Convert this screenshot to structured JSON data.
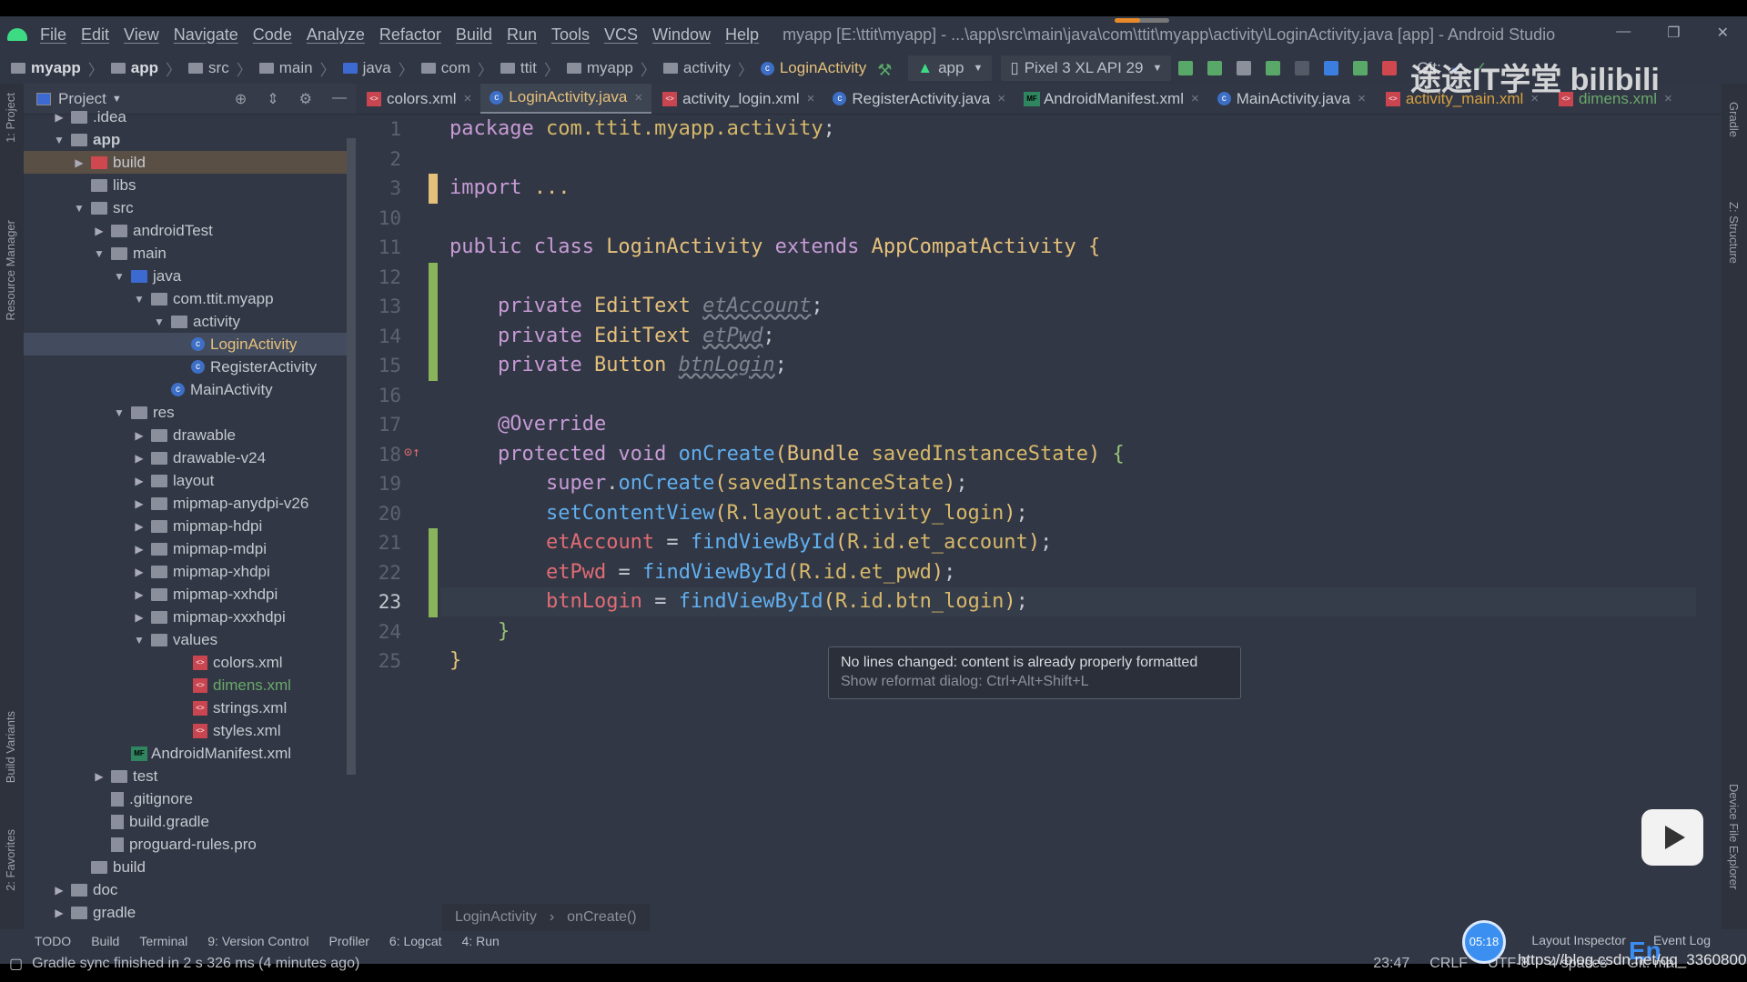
{
  "window": {
    "title": "myapp [E:\\ttit\\myapp] - ...\\app\\src\\main\\java\\com\\ttit\\myapp\\activity\\LoginActivity.java [app] - Android Studio",
    "menu": [
      "File",
      "Edit",
      "View",
      "Navigate",
      "Code",
      "Analyze",
      "Refactor",
      "Build",
      "Run",
      "Tools",
      "VCS",
      "Window",
      "Help"
    ]
  },
  "breadcrumb": [
    "myapp",
    "app",
    "src",
    "main",
    "java",
    "com",
    "ttit",
    "myapp",
    "activity",
    "LoginActivity"
  ],
  "toolbar": {
    "run_config": "app",
    "device": "Pixel 3 XL API 29",
    "git_label": "Git:"
  },
  "project_panel": {
    "title": "Project",
    "items": [
      {
        "label": ".idea",
        "depth": 1,
        "arrow": "▶",
        "icon": "folder"
      },
      {
        "label": "app",
        "depth": 1,
        "arrow": "▼",
        "icon": "folder",
        "bold": true
      },
      {
        "label": "build",
        "depth": 2,
        "arrow": "▶",
        "icon": "folder-red",
        "state": "hl"
      },
      {
        "label": "libs",
        "depth": 2,
        "arrow": "",
        "icon": "folder"
      },
      {
        "label": "src",
        "depth": 2,
        "arrow": "▼",
        "icon": "folder"
      },
      {
        "label": "androidTest",
        "depth": 3,
        "arrow": "▶",
        "icon": "folder"
      },
      {
        "label": "main",
        "depth": 3,
        "arrow": "▼",
        "icon": "folder"
      },
      {
        "label": "java",
        "depth": 4,
        "arrow": "▼",
        "icon": "folder-blue"
      },
      {
        "label": "com.ttit.myapp",
        "depth": 5,
        "arrow": "▼",
        "icon": "folder"
      },
      {
        "label": "activity",
        "depth": 6,
        "arrow": "▼",
        "icon": "folder"
      },
      {
        "label": "LoginActivity",
        "depth": 7,
        "arrow": "",
        "icon": "class",
        "state": "sel"
      },
      {
        "label": "RegisterActivity",
        "depth": 7,
        "arrow": "",
        "icon": "class"
      },
      {
        "label": "MainActivity",
        "depth": 6,
        "arrow": "",
        "icon": "class"
      },
      {
        "label": "res",
        "depth": 4,
        "arrow": "▼",
        "icon": "folder"
      },
      {
        "label": "drawable",
        "depth": 5,
        "arrow": "▶",
        "icon": "folder"
      },
      {
        "label": "drawable-v24",
        "depth": 5,
        "arrow": "▶",
        "icon": "folder"
      },
      {
        "label": "layout",
        "depth": 5,
        "arrow": "▶",
        "icon": "folder"
      },
      {
        "label": "mipmap-anydpi-v26",
        "depth": 5,
        "arrow": "▶",
        "icon": "folder"
      },
      {
        "label": "mipmap-hdpi",
        "depth": 5,
        "arrow": "▶",
        "icon": "folder"
      },
      {
        "label": "mipmap-mdpi",
        "depth": 5,
        "arrow": "▶",
        "icon": "folder"
      },
      {
        "label": "mipmap-xhdpi",
        "depth": 5,
        "arrow": "▶",
        "icon": "folder"
      },
      {
        "label": "mipmap-xxhdpi",
        "depth": 5,
        "arrow": "▶",
        "icon": "folder"
      },
      {
        "label": "mipmap-xxxhdpi",
        "depth": 5,
        "arrow": "▶",
        "icon": "folder"
      },
      {
        "label": "values",
        "depth": 5,
        "arrow": "▼",
        "icon": "folder"
      },
      {
        "label": "colors.xml",
        "depth": 7,
        "arrow": "",
        "icon": "xml"
      },
      {
        "label": "dimens.xml",
        "depth": 7,
        "arrow": "",
        "icon": "xml",
        "color": "#6aa86a"
      },
      {
        "label": "strings.xml",
        "depth": 7,
        "arrow": "",
        "icon": "xml"
      },
      {
        "label": "styles.xml",
        "depth": 7,
        "arrow": "",
        "icon": "xml"
      },
      {
        "label": "AndroidManifest.xml",
        "depth": 4,
        "arrow": "",
        "icon": "mf"
      },
      {
        "label": "test",
        "depth": 3,
        "arrow": "▶",
        "icon": "folder"
      },
      {
        "label": ".gitignore",
        "depth": 3,
        "arrow": "",
        "icon": "doc"
      },
      {
        "label": "build.gradle",
        "depth": 3,
        "arrow": "",
        "icon": "doc"
      },
      {
        "label": "proguard-rules.pro",
        "depth": 3,
        "arrow": "",
        "icon": "doc"
      },
      {
        "label": "build",
        "depth": 2,
        "arrow": "",
        "icon": "folder"
      },
      {
        "label": "doc",
        "depth": 1,
        "arrow": "▶",
        "icon": "folder"
      },
      {
        "label": "gradle",
        "depth": 1,
        "arrow": "▶",
        "icon": "folder"
      }
    ]
  },
  "side_tabs": {
    "project": "1: Project",
    "resource": "Resource Manager",
    "variants": "Build Variants",
    "favorites": "2: Favorites",
    "gradle": "Gradle",
    "structure": "Z: Structure",
    "device": "Device File Explorer"
  },
  "tabs": [
    {
      "label": "colors.xml",
      "icon": "xml"
    },
    {
      "label": "LoginActivity.java",
      "icon": "class",
      "active": true
    },
    {
      "label": "activity_login.xml",
      "icon": "xml"
    },
    {
      "label": "RegisterActivity.java",
      "icon": "class"
    },
    {
      "label": "AndroidManifest.xml",
      "icon": "mf"
    },
    {
      "label": "MainActivity.java",
      "icon": "class"
    },
    {
      "label": "activity_main.xml",
      "icon": "xml",
      "color": "gold"
    },
    {
      "label": "dimens.xml",
      "icon": "xml",
      "color": "green"
    }
  ],
  "code": {
    "current_line": "23",
    "lines": [
      {
        "n": "1",
        "html": "<span class='kw'>package </span><span class='pn'>com.ttit.myapp.activity</span><span class='df'>;</span>"
      },
      {
        "n": "2",
        "html": ""
      },
      {
        "n": "3",
        "html": "<span class='kw'>import </span><span class='br'>...</span>"
      },
      {
        "n": "10",
        "html": ""
      },
      {
        "n": "11",
        "html": "<span class='kw'>public class </span><span class='ty'>LoginActivity </span><span class='kw'>extends </span><span class='ty'>AppCompatActivity </span><span class='br'>{</span>"
      },
      {
        "n": "12",
        "html": ""
      },
      {
        "n": "13",
        "html": "    <span class='kw'>private </span><span class='ty'>EditText </span><span class='it'>etAccount</span><span class='df'>;</span>"
      },
      {
        "n": "14",
        "html": "    <span class='kw'>private </span><span class='ty'>EditText </span><span class='it'>etPwd</span><span class='df'>;</span>"
      },
      {
        "n": "15",
        "html": "    <span class='kw'>private </span><span class='ty'>Button </span><span class='it'>btnLogin</span><span class='df'>;</span>"
      },
      {
        "n": "16",
        "html": ""
      },
      {
        "n": "17",
        "html": "    <span class='kw'>@Override</span>"
      },
      {
        "n": "18",
        "html": "    <span class='kw'>protected void </span><span class='fn'>onCreate</span><span class='br'>(</span><span class='ty'>Bundle </span><span class='pn'>savedInstanceState</span><span class='br'>) </span><span class='gr'>{</span>"
      },
      {
        "n": "19",
        "html": "        <span class='kw'>super</span><span class='df'>.</span><span class='fn'>onCreate</span><span class='br'>(</span><span class='pn'>savedInstanceState</span><span class='br'>)</span><span class='df'>;</span>"
      },
      {
        "n": "20",
        "html": "        <span class='fn'>setContentView</span><span class='br'>(</span><span class='pn'>R.layout.activity_login</span><span class='br'>)</span><span class='df'>;</span>"
      },
      {
        "n": "21",
        "html": "        <span class='fld'>etAccount </span><span class='df'>= </span><span class='fn'>findViewById</span><span class='br'>(</span><span class='pn'>R.id.et_account</span><span class='br'>)</span><span class='df'>;</span>"
      },
      {
        "n": "22",
        "html": "        <span class='fld'>etPwd </span><span class='df'>= </span><span class='fn'>findViewById</span><span class='br'>(</span><span class='pn'>R.id.et_pwd</span><span class='br'>)</span><span class='df'>;</span>"
      },
      {
        "n": "23",
        "html": "        <span class='fld'>btnLogin </span><span class='df'>= </span><span class='fn'>findViewById</span><span class='br'>(</span><span class='pn'>R.id.btn_login</span><span class='br'>)</span><span class='df'>;</span>"
      },
      {
        "n": "24",
        "html": "    <span class='gr'>}</span>"
      },
      {
        "n": "25",
        "html": "<span class='br'>}</span>"
      }
    ]
  },
  "tooltip": {
    "line1": "No lines changed: content is already properly formatted",
    "line2": "Show reformat dialog: Ctrl+Alt+Shift+L"
  },
  "editor_breadcrumb": [
    "LoginActivity",
    "onCreate()"
  ],
  "tool_windows": [
    "TODO",
    "Build",
    "Terminal",
    "9: Version Control",
    "Profiler",
    "6: Logcat",
    "4: Run"
  ],
  "tool_windows_right": [
    "Layout Inspector",
    "Event Log"
  ],
  "status": {
    "message": "Gradle sync finished in 2 s 326 ms (4 minutes ago)",
    "position": "23:47",
    "line_sep": "CRLF",
    "encoding": "UTF-8",
    "indent": "4 spaces",
    "git": "Git: ma"
  },
  "overlay": {
    "timer": "05:18",
    "watermark": "https://blog.csdn.net/qq_33608000",
    "brand": "途途IT学堂 bilibili",
    "ime": "En"
  }
}
